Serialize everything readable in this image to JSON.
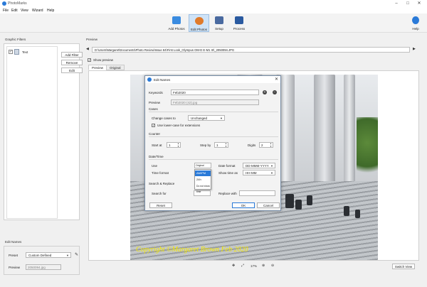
{
  "app": {
    "title": "PhotoMarks"
  },
  "menu": [
    "File",
    "Edit",
    "View",
    "Wizard",
    "Help"
  ],
  "toolbar": {
    "items": [
      {
        "label": "Add Photos",
        "icon": "add-photos-icon",
        "color": "#3a8be0"
      },
      {
        "label": "Edit Photos",
        "icon": "edit-photos-icon",
        "color": "#e07a2a"
      },
      {
        "label": "Setup",
        "icon": "setup-icon",
        "color": "#4a6aa0"
      },
      {
        "label": "Process",
        "icon": "process-icon",
        "color": "#2a5aa0"
      }
    ],
    "help_label": "Help"
  },
  "left": {
    "graphic_filters_label": "Graphic Filters",
    "filter_item": "Text",
    "buttons": {
      "add": "Add Filter",
      "remove": "Remove",
      "edit": "Edit"
    },
    "edit_names_label": "Edit Names",
    "preset_label": "Preset",
    "preset_value": "Custom Defined",
    "preview_label": "Preview",
    "preview_value": "2050094.jpg"
  },
  "preview": {
    "label": "Preview",
    "path": "D:\\Users\\Margaret\\Documents\\Photo Review\\Issue 84\\First Look_Olympus OM-D E-M1 III\\_2050094.JPG",
    "show_preview": "Show preview",
    "tabs": [
      "Preview",
      "Original"
    ],
    "copyright": "Copyright ©Margaret Brown Feb 2020",
    "zoom": "17%",
    "view_button": "Switch View"
  },
  "dialog": {
    "title": "Edit Names",
    "keywords_label": "Keywords",
    "keywords_value": "Feb2020",
    "preview_label": "Preview",
    "preview_value": "Feb2020 (42).jpg",
    "cases_label": "Cases",
    "change_cases_label": "Change cases to",
    "change_cases_value": "Unchanged",
    "lowercase_label": "Use lower-case for extensions",
    "counter_label": "Counter",
    "start_label": "Start at",
    "start_value": "1",
    "step_label": "Step by",
    "step_value": "1",
    "digits_label": "Digits",
    "digits_value": "2",
    "datetime_label": "Date/Time",
    "use_label": "Use",
    "use_value": "Original photo date",
    "date_format_label": "Date format",
    "date_format_value": "DD-MMM-YYYY",
    "time_format_label": "Time format",
    "time_format_value": "AM/PM",
    "show_time_label": "Show time as",
    "show_time_value": "HH-MM",
    "time_options": [
      "AM/PM",
      "24h",
      "Do not show time"
    ],
    "search_replace_label": "Search & Replace",
    "search_for_label": "Search for",
    "replace_with_label": "Replace with",
    "reset": "Reset",
    "ok": "OK",
    "cancel": "Cancel"
  }
}
